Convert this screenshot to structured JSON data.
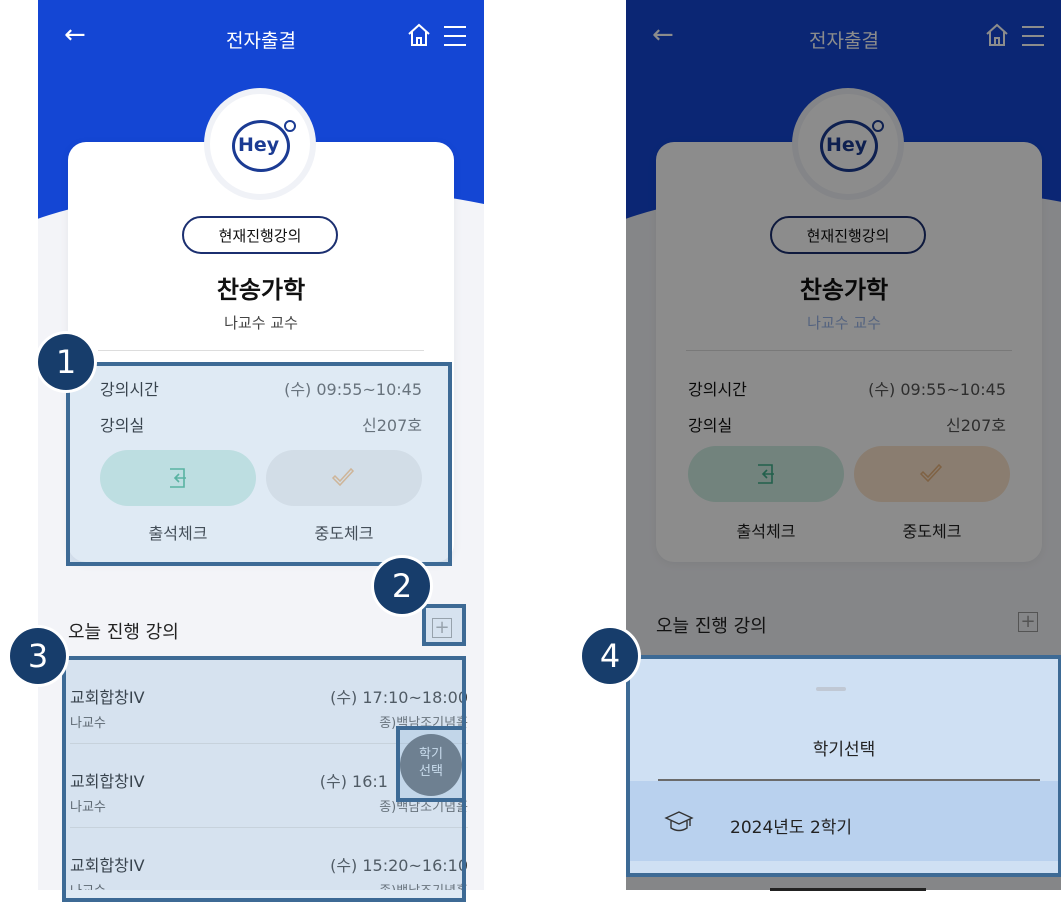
{
  "header": {
    "title": "전자출결"
  },
  "current": {
    "badge": "현재진행강의",
    "course": "찬송가학",
    "professor": "나교수 교수",
    "time_label": "강의시간",
    "time_value": "(수) 09:55~10:45",
    "room_label": "강의실",
    "room_value": "신207호",
    "checkin_label": "출석체크",
    "midcheck_label": "중도체크"
  },
  "logo_text": "Hey",
  "today": {
    "title": "오늘 진행 강의",
    "plus": "+",
    "items": [
      {
        "name": "교회합창IV",
        "prof": "나교수",
        "time": "(수) 17:10~18:00",
        "room": "종)백남조기념홀"
      },
      {
        "name": "교회합창IV",
        "prof": "나교수",
        "time": "(수) 16:1",
        "room": "종)백남조기념홀"
      },
      {
        "name": "교회합창IV",
        "prof": "나교수",
        "time": "(수) 15:20~16:10",
        "room": "종)백남조기념홀"
      }
    ]
  },
  "fab": {
    "line1": "학기",
    "line2": "선택"
  },
  "annotations": [
    "1",
    "2",
    "3",
    "4"
  ],
  "sheet": {
    "title": "학기선택",
    "semester": "2024년도 2학기"
  },
  "colors": {
    "primary": "#1446d4",
    "highlight": "#3d6a95",
    "badge": "#173d6b",
    "checkin": "#cfeee4",
    "midcheck": "#ececec"
  }
}
